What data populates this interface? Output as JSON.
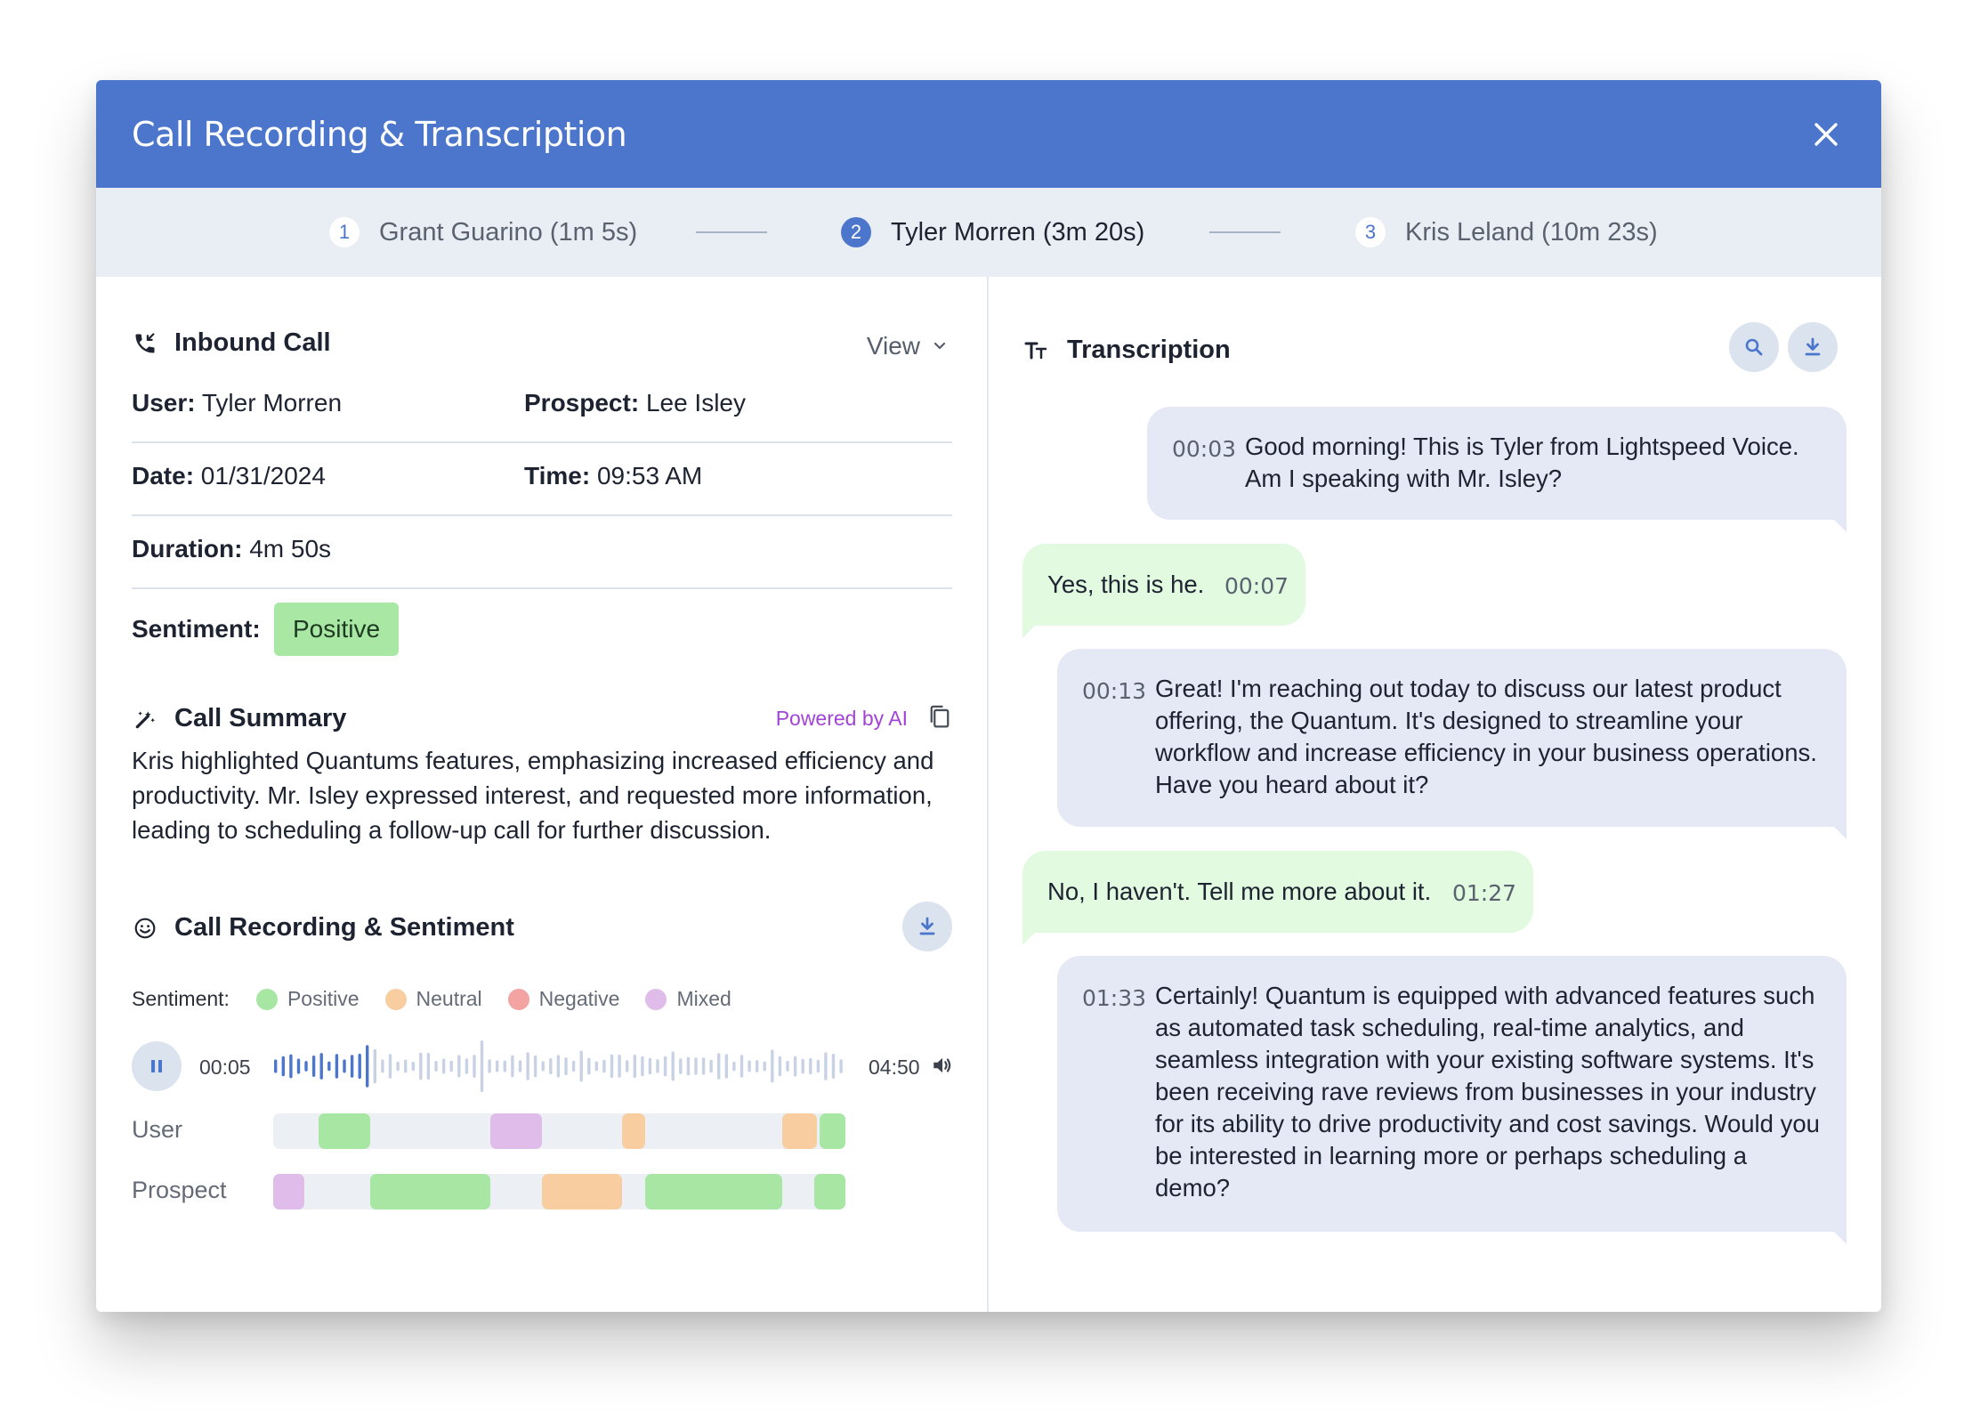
{
  "modal": {
    "title": "Call Recording & Transcription"
  },
  "steps": [
    {
      "num": "1",
      "label": "Grant Guarino (1m 5s)",
      "active": false
    },
    {
      "num": "2",
      "label": "Tyler Morren (3m 20s)",
      "active": true
    },
    {
      "num": "3",
      "label": "Kris Leland (10m 23s)",
      "active": false
    }
  ],
  "call": {
    "heading": "Inbound Call",
    "view_label": "View",
    "user_label": "User:",
    "user_value": "Tyler Morren",
    "prospect_label": "Prospect:",
    "prospect_value": "Lee Isley",
    "date_label": "Date:",
    "date_value": "01/31/2024",
    "time_label": "Time:",
    "time_value": "09:53 AM",
    "duration_label": "Duration:",
    "duration_value": "4m 50s",
    "sentiment_label": "Sentiment:",
    "sentiment_value": "Positive"
  },
  "summary": {
    "heading": "Call Summary",
    "powered_by": "Powered by AI",
    "text": "Kris highlighted Quantums features, emphasizing increased efficiency and productivity. Mr. Isley expressed interest, and requested more information, leading to scheduling a follow-up call for further discussion."
  },
  "recording": {
    "heading": "Call Recording & Sentiment",
    "legend_label": "Sentiment:",
    "legend": [
      {
        "label": "Positive",
        "color": "#a8e6a3"
      },
      {
        "label": "Neutral",
        "color": "#f8cda0"
      },
      {
        "label": "Negative",
        "color": "#f4a3a3"
      },
      {
        "label": "Mixed",
        "color": "#dfbcea"
      }
    ],
    "current_time": "00:05",
    "total_time": "04:50",
    "progress": 0.17,
    "tracks": [
      {
        "label": "User",
        "segments": [
          {
            "start": 0.08,
            "end": 0.17,
            "sentiment": "Positive"
          },
          {
            "start": 0.38,
            "end": 0.47,
            "sentiment": "Mixed"
          },
          {
            "start": 0.61,
            "end": 0.65,
            "sentiment": "Neutral"
          },
          {
            "start": 0.89,
            "end": 0.95,
            "sentiment": "Neutral"
          },
          {
            "start": 0.955,
            "end": 1.0,
            "sentiment": "Positive"
          }
        ]
      },
      {
        "label": "Prospect",
        "segments": [
          {
            "start": 0.0,
            "end": 0.055,
            "sentiment": "Mixed"
          },
          {
            "start": 0.17,
            "end": 0.38,
            "sentiment": "Positive"
          },
          {
            "start": 0.47,
            "end": 0.61,
            "sentiment": "Neutral"
          },
          {
            "start": 0.65,
            "end": 0.89,
            "sentiment": "Positive"
          },
          {
            "start": 0.945,
            "end": 1.0,
            "sentiment": "Positive"
          }
        ]
      }
    ]
  },
  "transcription": {
    "heading": "Transcription",
    "messages": [
      {
        "speaker": "user",
        "time": "00:03",
        "text": "Good morning! This is Tyler from Lightspeed Voice. Am I speaking with Mr. Isley?"
      },
      {
        "speaker": "prospect",
        "time": "00:07",
        "text": "Yes, this is he."
      },
      {
        "speaker": "user",
        "time": "00:13",
        "text": "Great! I'm reaching out today to discuss our latest product offering, the Quantum. It's designed to streamline your workflow and increase efficiency in your business operations. Have you heard about it?"
      },
      {
        "speaker": "prospect",
        "time": "01:27",
        "text": "No, I haven't. Tell me more about it."
      },
      {
        "speaker": "user",
        "time": "01:33",
        "text": "Certainly! Quantum is equipped with advanced features such as automated task scheduling, real-time analytics, and seamless integration with your existing software systems. It's been receiving rave reviews from businesses in your industry for its ability to drive productivity and cost savings. Would you be interested in learning more or perhaps scheduling a demo?"
      }
    ]
  }
}
